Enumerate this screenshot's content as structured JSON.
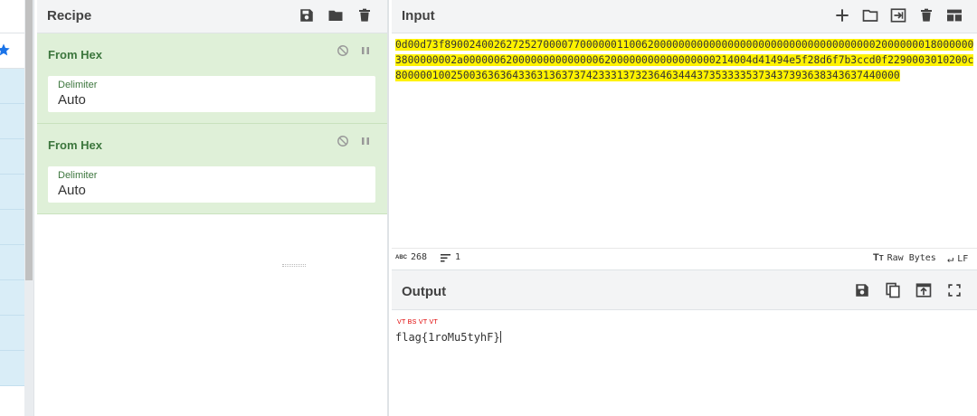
{
  "recipe": {
    "title": "Recipe",
    "operations": [
      {
        "name": "From Hex",
        "arg_label": "Delimiter",
        "arg_value": "Auto"
      },
      {
        "name": "From Hex",
        "arg_label": "Delimiter",
        "arg_value": "Auto"
      }
    ]
  },
  "input": {
    "title": "Input",
    "text": "0d00d73f890024002627252700007700000011006200000000000000000000000000000000000020000000180000003800000002a00000062000000000000006200000000000000000214004d41494e5f28d6f7b3ccd0f2290003010200c8000001002500363636433631363737423331373236463444373533335373437393638343637440000",
    "status": {
      "length_icon": "ABC",
      "length": "268",
      "lines": "1",
      "raw_bytes": "Raw Bytes",
      "newline": "LF"
    }
  },
  "output": {
    "title": "Output",
    "control_chars": "VT BS VT VT",
    "text": "flag{1roMu5tyhF}"
  },
  "colors": {
    "op_card_bg": "#dff0d8",
    "op_name": "#3c763d",
    "highlight": "#fff200",
    "header_bg": "#f3f4f5",
    "fav_star": "#1a73e8"
  }
}
